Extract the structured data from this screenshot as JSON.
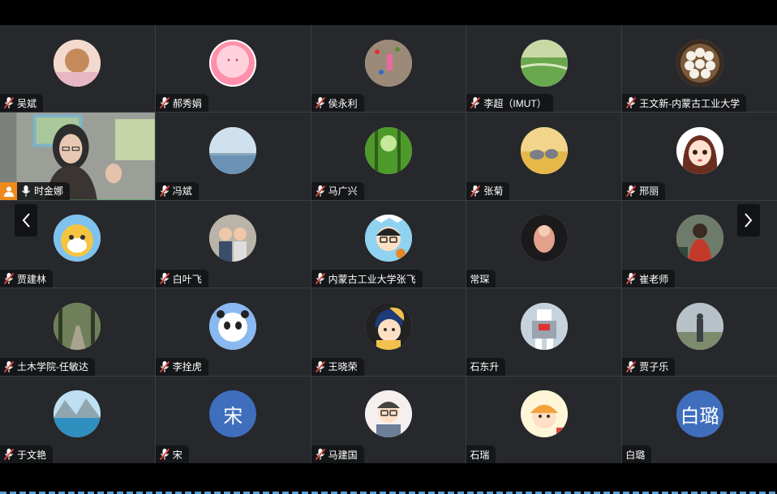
{
  "participants": [
    {
      "name": "吴斌",
      "muted": true,
      "avatar": "child-photo",
      "colors": [
        "#f4d9cf",
        "#c48a5a"
      ]
    },
    {
      "name": "郝秀娟",
      "muted": true,
      "avatar": "pink-blob",
      "colors": [
        "#ffd1dc",
        "#ff8fab"
      ]
    },
    {
      "name": "侯永利",
      "muted": true,
      "avatar": "climbing-wall",
      "colors": [
        "#9c8a78",
        "#5b8c3a"
      ]
    },
    {
      "name": "李超（IMUT）",
      "muted": true,
      "avatar": "grassland",
      "colors": [
        "#6aa84f",
        "#c9d9a5"
      ]
    },
    {
      "name": "王文新-内蒙古工业大学",
      "muted": true,
      "avatar": "dumplings",
      "colors": [
        "#f5f1e6",
        "#3b2a20"
      ]
    },
    {
      "name": "时金娜",
      "muted": false,
      "avatar": "live-video",
      "colors": [
        "#8a8d88",
        "#2d2d2d"
      ],
      "host": true
    },
    {
      "name": "冯斌",
      "muted": true,
      "avatar": "sky-lake",
      "colors": [
        "#cfe0ee",
        "#6c93b5"
      ]
    },
    {
      "name": "马广兴",
      "muted": true,
      "avatar": "forest",
      "colors": [
        "#4d9a2a",
        "#c6e89a"
      ]
    },
    {
      "name": "张菊",
      "muted": true,
      "avatar": "elephants",
      "colors": [
        "#e6b84a",
        "#7a7f86"
      ]
    },
    {
      "name": "邢丽",
      "muted": true,
      "avatar": "cartoon-girl",
      "colors": [
        "#ffffff",
        "#6b2e1e"
      ]
    },
    {
      "name": "贾建林",
      "muted": true,
      "avatar": "cartoon-cat",
      "colors": [
        "#f4c542",
        "#ffffff"
      ]
    },
    {
      "name": "白叶飞",
      "muted": true,
      "avatar": "children",
      "colors": [
        "#b9b3a8",
        "#3a4d6b"
      ]
    },
    {
      "name": "内蒙古工业大学张飞",
      "muted": true,
      "avatar": "cartoon-boy",
      "colors": [
        "#45b6e6",
        "#ffffff"
      ]
    },
    {
      "name": "常琛",
      "muted": false,
      "avatar": "figurine",
      "colors": [
        "#1a1a1a",
        "#e3a08a"
      ]
    },
    {
      "name": "崔老师",
      "muted": true,
      "avatar": "painting",
      "colors": [
        "#c33a2b",
        "#2d4a3a"
      ]
    },
    {
      "name": "土木学院-任敏达",
      "muted": true,
      "avatar": "park-road",
      "colors": [
        "#6f7f5a",
        "#2f3a26"
      ]
    },
    {
      "name": "李拴虎",
      "muted": true,
      "avatar": "panda-mascot",
      "colors": [
        "#8ab8f0",
        "#ffffff"
      ]
    },
    {
      "name": "王晓荣",
      "muted": true,
      "avatar": "pearl-earring-cartoon",
      "colors": [
        "#f2c14e",
        "#1e3a78"
      ]
    },
    {
      "name": "石东升",
      "muted": false,
      "avatar": "robot",
      "colors": [
        "#9aa4ae",
        "#ffffff"
      ]
    },
    {
      "name": "贾子乐",
      "muted": true,
      "avatar": "person-outdoor",
      "colors": [
        "#b7c1c8",
        "#3a3f44"
      ]
    },
    {
      "name": "于文艳",
      "muted": true,
      "avatar": "mountain-lake",
      "colors": [
        "#2f8fbf",
        "#4a7a3a"
      ]
    },
    {
      "name": "宋",
      "muted": true,
      "avatar": "initial",
      "initial": "宋",
      "colors": [
        "#3f6ebd",
        "#ffffff"
      ]
    },
    {
      "name": "马建国",
      "muted": true,
      "avatar": "cartoon-man",
      "colors": [
        "#f5f0ee",
        "#6b7f99"
      ]
    },
    {
      "name": "石瑞",
      "muted": false,
      "avatar": "cartoon-kid",
      "colors": [
        "#fff6d8",
        "#f2a23a"
      ]
    },
    {
      "name": "白璐",
      "muted": false,
      "avatar": "initial",
      "initial": "白璐",
      "colors": [
        "#3f6ebd",
        "#ffffff"
      ]
    }
  ],
  "nav": {
    "prev": "‹",
    "next": "›"
  },
  "theme": {
    "accent": "#3cb95a",
    "host_badge": "#f08a1c",
    "tile_bg": "#26282c",
    "mic_muted": "#e0453a"
  }
}
